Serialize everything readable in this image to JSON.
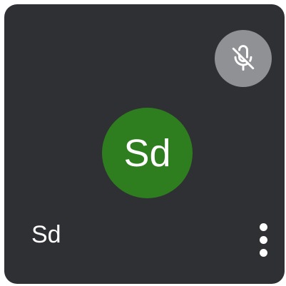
{
  "participant": {
    "name": "Sd",
    "initials": "Sd",
    "avatar_color": "#2e7d1f"
  },
  "mic_status": {
    "icon": "mic-off-icon",
    "badge_color": "#8f9195"
  },
  "more_options": {
    "icon": "more-vert-icon"
  },
  "tile": {
    "background": "#2f3034"
  }
}
